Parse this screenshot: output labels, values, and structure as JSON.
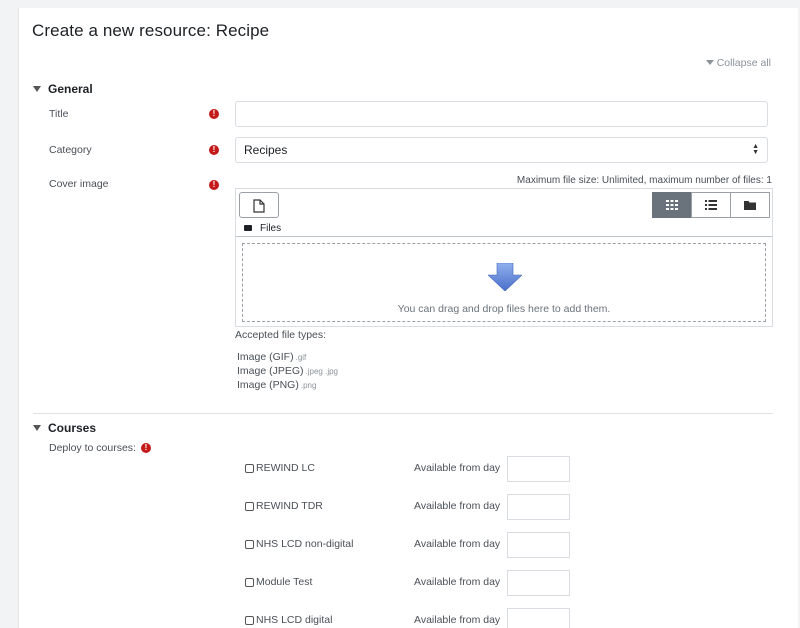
{
  "page": {
    "title": "Create a new resource: Recipe",
    "collapse_all": "Collapse all"
  },
  "general": {
    "heading": "General",
    "title_label": "Title",
    "title_value": "",
    "category_label": "Category",
    "category_value": "Recipes",
    "cover_label": "Cover image",
    "required_icon": "exclamation-icon"
  },
  "filepicker": {
    "max_size": "Maximum file size: Unlimited, maximum number of files: 1",
    "path": "Files",
    "drop_text": "You can drag and drop files here to add them.",
    "accepted_label": "Accepted file types:",
    "types": [
      {
        "name": "Image (GIF)",
        "ext": ".gif"
      },
      {
        "name": "Image (JPEG)",
        "ext": ".jpeg .jpg"
      },
      {
        "name": "Image (PNG)",
        "ext": ".png"
      }
    ],
    "active_view": "grid",
    "colors": {
      "active_view_bg": "#6a737b",
      "drop_arrow": "#5b7fd6"
    }
  },
  "courses": {
    "heading": "Courses",
    "deploy_label": "Deploy to courses:",
    "available_label": "Available from day",
    "items": [
      {
        "name": "REWIND LC",
        "checked": false
      },
      {
        "name": "REWIND TDR",
        "checked": false
      },
      {
        "name": "NHS LCD non-digital",
        "checked": false
      },
      {
        "name": "Module Test",
        "checked": false
      },
      {
        "name": "NHS LCD digital",
        "checked": false
      }
    ]
  },
  "colors": {
    "required": "#c41a1a",
    "text": "#1d2125",
    "muted": "#495057"
  }
}
